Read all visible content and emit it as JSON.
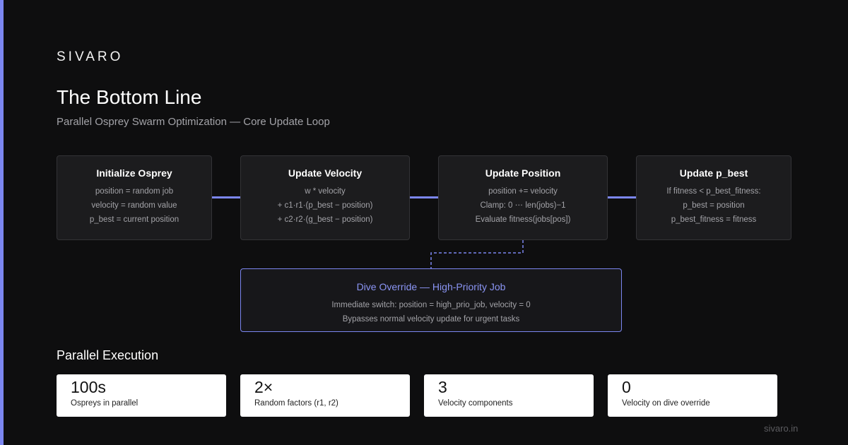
{
  "brand": "SIVARO",
  "title": "The Bottom Line",
  "subtitle": "Parallel Osprey Swarm Optimization — Core Update Loop",
  "steps": [
    {
      "title": "Initialize Osprey",
      "lines": [
        "position = random job",
        "velocity = random value",
        "p_best = current position"
      ]
    },
    {
      "title": "Update Velocity",
      "lines": [
        "w * velocity",
        "+ c1·r1·(p_best − position)",
        "+ c2·r2·(g_best − position)"
      ]
    },
    {
      "title": "Update Position",
      "lines": [
        "position += velocity",
        "Clamp: 0 ⋯ len(jobs)−1",
        "Evaluate fitness(jobs[pos])"
      ]
    },
    {
      "title": "Update p_best",
      "lines": [
        "If fitness < p_best_fitness:",
        "p_best = position",
        "p_best_fitness = fitness"
      ]
    }
  ],
  "dive": {
    "title": "Dive Override — High-Priority Job",
    "lines": [
      "Immediate switch: position = high_prio_job, velocity = 0",
      "Bypasses normal velocity update for urgent tasks"
    ]
  },
  "section_title": "Parallel Execution",
  "stats": [
    {
      "value": "100s",
      "label": "Ospreys in parallel"
    },
    {
      "value": "2×",
      "label": "Random factors (r1, r2)"
    },
    {
      "value": "3",
      "label": "Velocity components"
    },
    {
      "value": "0",
      "label": "Velocity on dive override"
    }
  ],
  "footer": "sivaro.in",
  "colors": {
    "accent": "#7b86f0",
    "background": "#0e0e0f",
    "box": "#1c1c1e",
    "dive_title": "#8b95f4"
  }
}
